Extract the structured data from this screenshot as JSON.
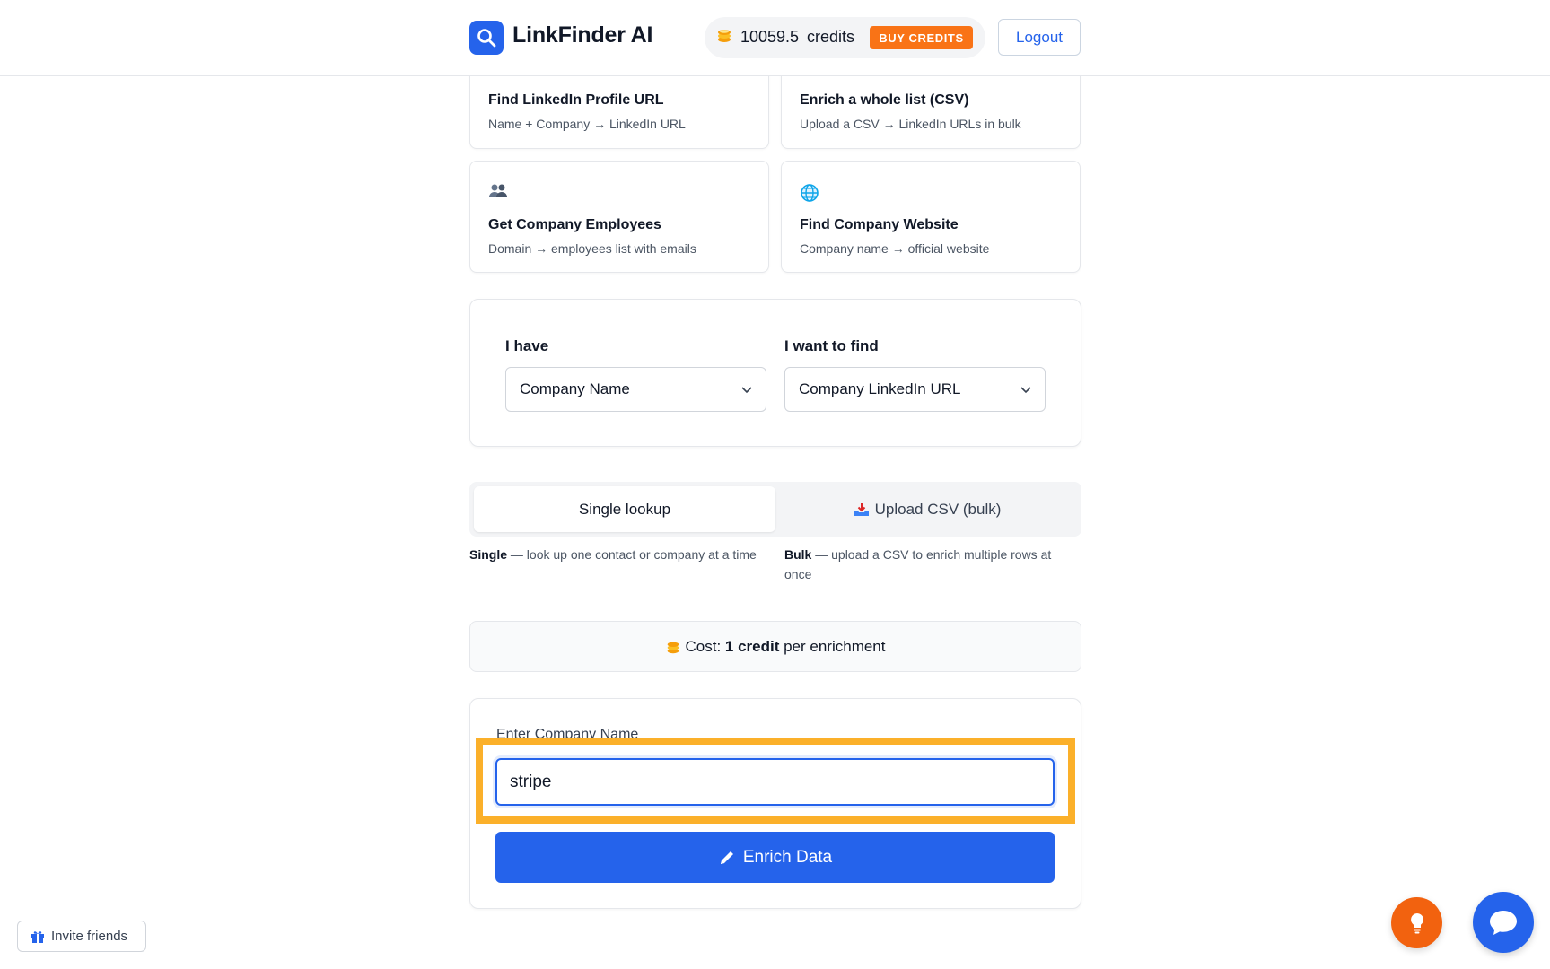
{
  "header": {
    "app_name": "LinkFinder AI",
    "credits_value": "10059.5",
    "credits_label": "credits",
    "buy_label": "BUY CREDITS",
    "logout_label": "Logout"
  },
  "features": [
    {
      "title": "Find LinkedIn Profile URL",
      "desc": "Name + Company → LinkedIn URL",
      "icon": "none"
    },
    {
      "title": "Enrich a whole list (CSV)",
      "desc": "Upload a CSV → LinkedIn URLs in bulk",
      "icon": "none"
    },
    {
      "title": "Get Company Employees",
      "desc": "Domain → employees list with emails",
      "icon": "people-icon"
    },
    {
      "title": "Find Company Website",
      "desc": "Company name → official website",
      "icon": "globe-icon"
    }
  ],
  "selectors": {
    "have_label": "I have",
    "have_value": "Company Name",
    "find_label": "I want to find",
    "find_value": "Company LinkedIn URL"
  },
  "modes": {
    "single_label": "Single lookup",
    "bulk_label": "Upload CSV (bulk)",
    "single_desc_bold": "Single",
    "single_desc": " — look up one contact or company at a time",
    "bulk_desc_bold": "Bulk",
    "bulk_desc": " — upload a CSV to enrich multiple rows at once"
  },
  "cost": {
    "prefix": "Cost: ",
    "amount": "1 credit",
    "suffix": " per enrichment"
  },
  "form": {
    "label": "Enter Company Name",
    "input_value": "stripe",
    "submit_label": "Enrich Data"
  },
  "footer": {
    "invite_label": "Invite friends"
  },
  "colors": {
    "accent": "#2563eb",
    "buy": "#f97316",
    "highlight": "#fbb02a"
  }
}
